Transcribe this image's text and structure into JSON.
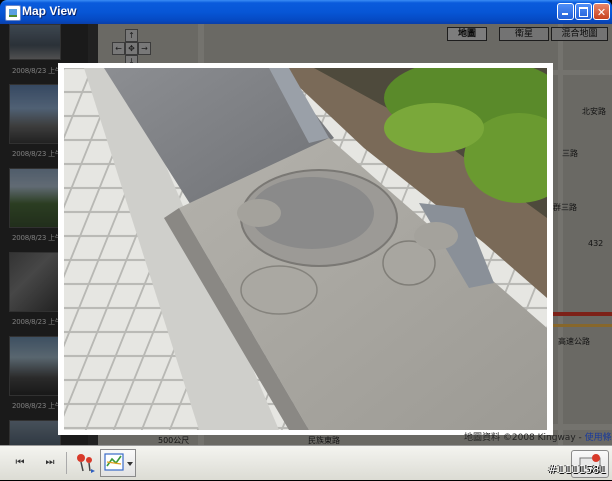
{
  "window": {
    "title": "Map View",
    "controls": [
      "minimize-icon",
      "maximize-icon",
      "close-icon"
    ]
  },
  "thumbnails": [
    {
      "caption": "2008/8/23 上午"
    },
    {
      "caption": "2008/8/23 上午"
    },
    {
      "caption": "2008/8/23 上午"
    },
    {
      "caption": "2008/8/23 上午"
    },
    {
      "caption": "2008/8/23 上午"
    }
  ],
  "map": {
    "type_buttons": [
      "地圖",
      "衛星",
      "混合地圖"
    ],
    "active_type": "地圖",
    "pan_controls": [
      "↑",
      "←",
      "✥",
      "→",
      "↓"
    ],
    "labels": [
      "北安路",
      "三路",
      "群三路",
      "432",
      "高速公路",
      "民族東路",
      "500公尺"
    ],
    "copyright_text": "地圖資料 ©2008 Kingway - ",
    "terms_link": "使用條款"
  },
  "toolbar": {
    "first_label": "⏮",
    "next_label": "⏭",
    "pin_icon": "map-pin-icon",
    "route_icon": "route-dropdown-icon"
  },
  "watermark": "#1111581",
  "colors": {
    "titlebar": "#0756d6",
    "map_road_red": "#d83a2a",
    "overlay": "rgba(0,0,0,0.42)"
  }
}
